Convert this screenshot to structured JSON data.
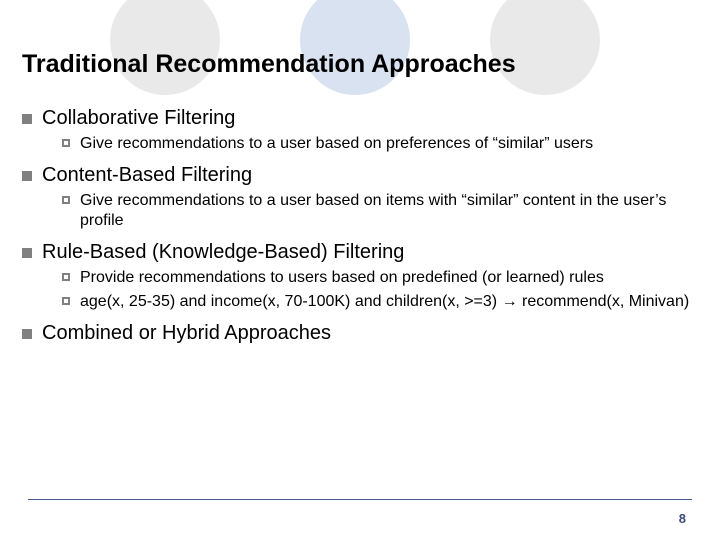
{
  "slide": {
    "title": "Traditional Recommendation Approaches",
    "page_number": "8",
    "items": [
      {
        "label": "Collaborative Filtering",
        "sub": [
          "Give recommendations to a user based on preferences of “similar” users"
        ]
      },
      {
        "label": "Content-Based Filtering",
        "sub": [
          "Give recommendations to a user based on items with “similar” content in the user’s profile"
        ]
      },
      {
        "label": "Rule-Based (Knowledge-Based) Filtering",
        "sub": [
          "Provide recommendations to users based on predefined (or learned) rules",
          "age(x, 25-35) and income(x, 70-100K) and children(x, >=3) → recommend(x, Minivan)"
        ]
      },
      {
        "label": "Combined or Hybrid Approaches",
        "sub": []
      }
    ]
  }
}
